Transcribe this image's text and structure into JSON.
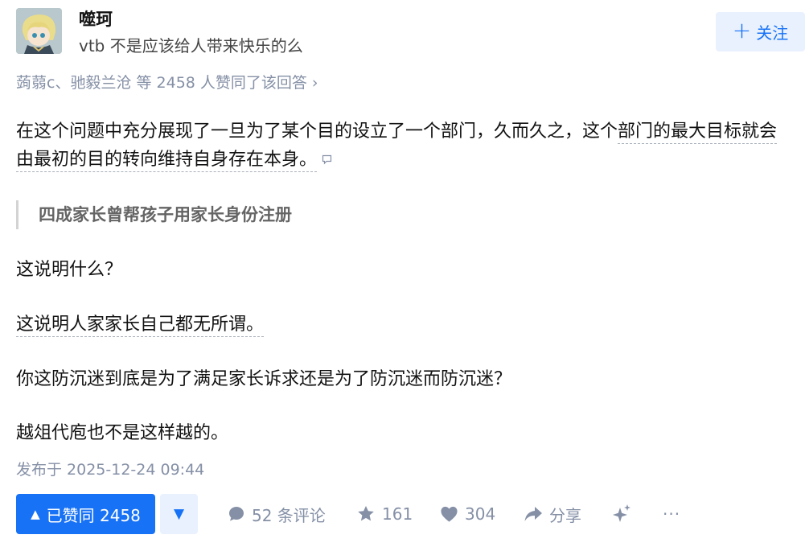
{
  "author": {
    "name": "噬珂",
    "bio": "vtb 不是应该给人带来快乐的么",
    "avatar_icon": "anime-avatar-icon"
  },
  "follow_button": {
    "icon": "plus-icon",
    "label": "关注"
  },
  "voters_line": "蒟蒻c、驰毅兰沧 等 2458 人赞同了该回答",
  "voters_chevron": "›",
  "content": {
    "p1_line1": "在这个问题中充分展现了一旦为了某个目的设立了一个部门，久而久之，这个",
    "p1_line1_highlight": "部门的最大目标就会",
    "p1_line2": "由最初的目的转向维持自身存在本身。",
    "quote": "四成家长曾帮孩子用家长身份注册",
    "p2": "这说明什么？",
    "p3": "这说明人家家长自己都无所谓。",
    "p4": "你这防沉迷到底是为了满足家长诉求还是为了防沉迷而防沉迷？",
    "p5": "越俎代庖也不是这样越的。"
  },
  "published": "发布于 2025-12-24 09:44",
  "actions": {
    "upvote_label": "已赞同 2458",
    "upvote_icon": "▲",
    "downvote_icon": "▼",
    "comments": "52 条评论",
    "favorites": "161",
    "likes": "304",
    "share": "分享",
    "more": "···"
  },
  "colors": {
    "brand_blue": "#1772f6",
    "light_blue_bg": "#e9f1ff",
    "meta_gray": "#8590a6"
  }
}
